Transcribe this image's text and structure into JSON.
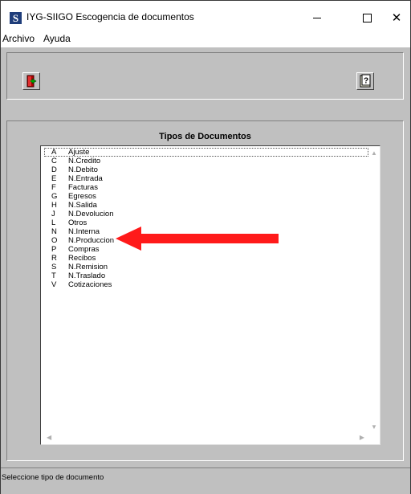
{
  "window": {
    "title": "IYG-SIIGO Escogencia de documentos",
    "app_icon_letter": "S",
    "minimize_glyph": "—",
    "maximize_glyph": "☐",
    "close_glyph": "✕"
  },
  "menu": {
    "items": [
      {
        "label": "Archivo"
      },
      {
        "label": "Ayuda"
      }
    ]
  },
  "toolbar": {
    "exit_icon": "exit-door-icon",
    "help_icon": "help-question-icon",
    "help_glyph": "?"
  },
  "panel": {
    "title": "Tipos de Documentos",
    "items": [
      {
        "code": "A",
        "name": "Ajuste"
      },
      {
        "code": "C",
        "name": "N.Credito"
      },
      {
        "code": "D",
        "name": "N.Debito"
      },
      {
        "code": "E",
        "name": "N.Entrada"
      },
      {
        "code": "F",
        "name": "Facturas"
      },
      {
        "code": "G",
        "name": "Egresos"
      },
      {
        "code": "H",
        "name": "N.Salida"
      },
      {
        "code": "J",
        "name": "N.Devolucion"
      },
      {
        "code": "L",
        "name": "Otros"
      },
      {
        "code": "N",
        "name": "N.Interna"
      },
      {
        "code": "O",
        "name": "N.Produccion"
      },
      {
        "code": "P",
        "name": "Compras"
      },
      {
        "code": "R",
        "name": "Recibos"
      },
      {
        "code": "S",
        "name": "N.Remision"
      },
      {
        "code": "T",
        "name": "N.Traslado"
      },
      {
        "code": "V",
        "name": "Cotizaciones"
      }
    ],
    "selected_index": 0
  },
  "status": {
    "text": "Seleccione tipo de documento"
  },
  "colors": {
    "window_bg": "#c0c0c0",
    "annotation_arrow": "#ff1a1a"
  }
}
